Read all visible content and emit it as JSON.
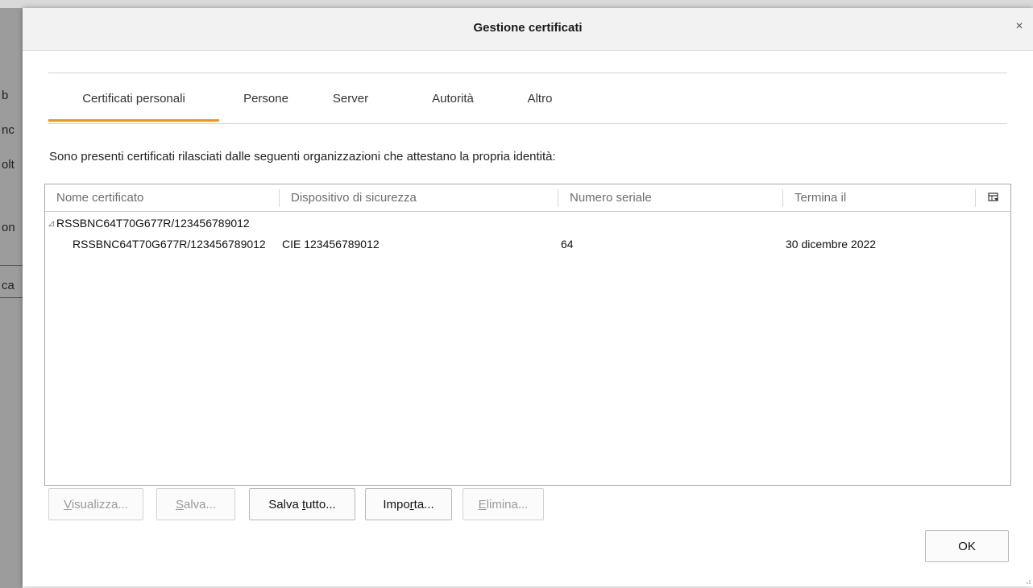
{
  "background": {
    "fragments": [
      "b",
      "nc",
      "olt",
      "on",
      "ca"
    ]
  },
  "dialog": {
    "title": "Gestione certificati",
    "close_glyph": "×"
  },
  "tabs": [
    {
      "label": "Certificati personali",
      "active": true
    },
    {
      "label": "Persone",
      "active": false
    },
    {
      "label": "Server",
      "active": false
    },
    {
      "label": "Autorità",
      "active": false
    },
    {
      "label": "Altro",
      "active": false
    }
  ],
  "description": "Sono presenti certificati rilasciati dalle seguenti organizzazioni che attestano la propria identità:",
  "table": {
    "columns": [
      "Nome certificato",
      "Dispositivo di sicurezza",
      "Numero seriale",
      "Termina il"
    ],
    "group": "RSSBNC64T70G677R/123456789012",
    "rows": [
      {
        "name": "RSSBNC64T70G677R/123456789012",
        "device": "CIE 123456789012",
        "serial": "64",
        "expires": "30 dicembre 2022"
      }
    ]
  },
  "buttons": {
    "view": {
      "pre": "",
      "u": "V",
      "post": "isualizza..."
    },
    "save": {
      "pre": "",
      "u": "S",
      "post": "alva..."
    },
    "save_all": {
      "pre": "Salva ",
      "u": "t",
      "post": "utto..."
    },
    "import": {
      "pre": "Impo",
      "u": "r",
      "post": "ta..."
    },
    "delete": {
      "pre": "",
      "u": "E",
      "post": "limina..."
    },
    "ok": "OK"
  },
  "colors": {
    "accent": "#ff9400"
  }
}
